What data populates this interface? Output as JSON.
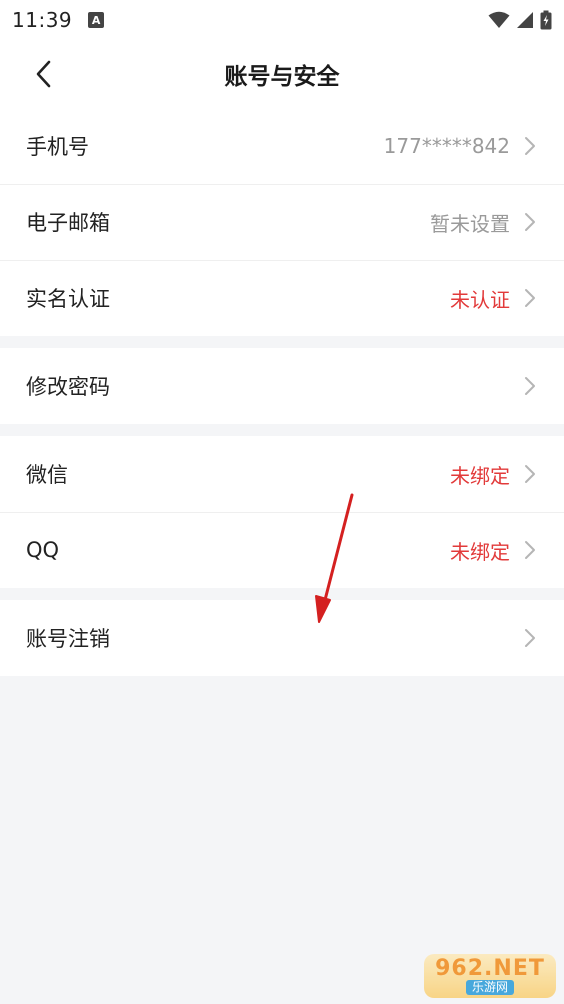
{
  "status_bar": {
    "time": "11:39",
    "notification_icon": "A",
    "icons": [
      "wifi-icon",
      "signal-icon",
      "battery-icon"
    ]
  },
  "header": {
    "title": "账号与安全",
    "back_icon": "chevron-left-icon"
  },
  "groups": [
    {
      "rows": [
        {
          "label": "手机号",
          "value": "177*****842",
          "value_color": "#9a9a9a"
        },
        {
          "label": "电子邮箱",
          "value": "暂未设置",
          "value_color": "#9a9a9a"
        },
        {
          "label": "实名认证",
          "value": "未认证",
          "value_color": "#e23a3a"
        }
      ]
    },
    {
      "rows": [
        {
          "label": "修改密码",
          "value": ""
        }
      ]
    },
    {
      "rows": [
        {
          "label": "微信",
          "value": "未绑定",
          "value_color": "#e23a3a"
        },
        {
          "label": "QQ",
          "value": "未绑定",
          "value_color": "#e23a3a"
        }
      ]
    },
    {
      "rows": [
        {
          "label": "账号注销",
          "value": ""
        }
      ]
    }
  ],
  "annotation": {
    "icon": "red-arrow-icon",
    "color": "#d42020"
  },
  "watermark": {
    "top": "962.NET",
    "bottom": "乐游网"
  }
}
